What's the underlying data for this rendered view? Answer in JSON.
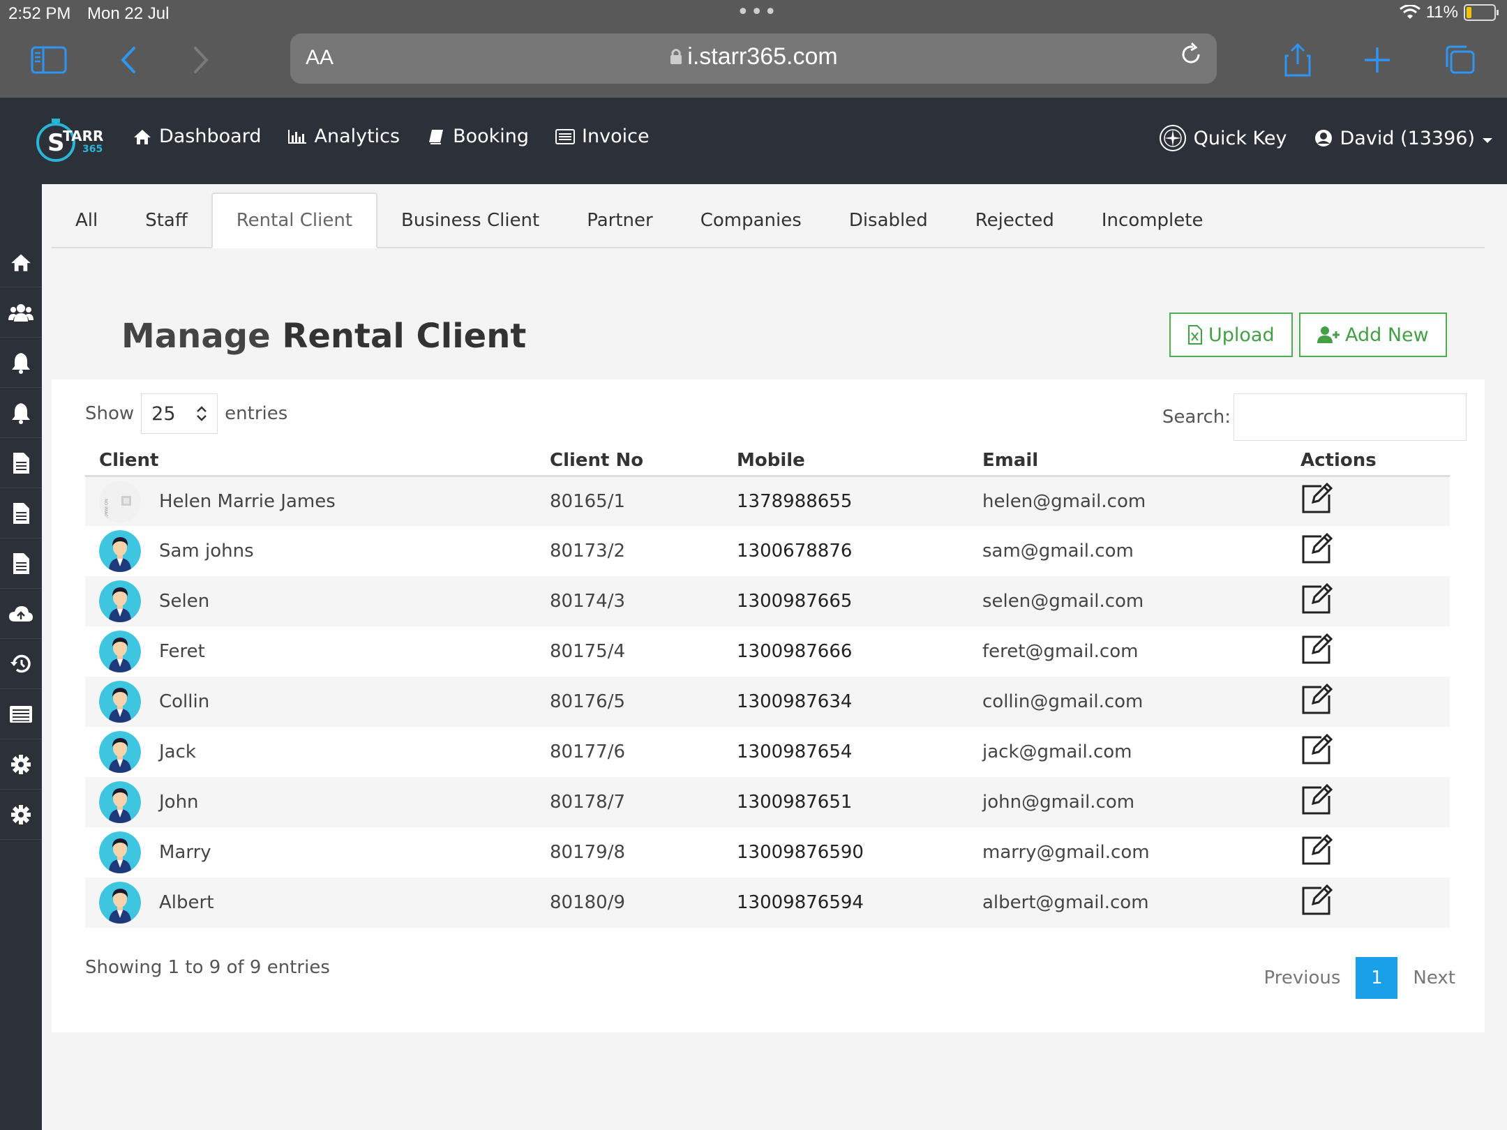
{
  "status_bar": {
    "time": "2:52 PM",
    "date": "Mon 22 Jul",
    "battery": "11%"
  },
  "browser": {
    "text_size": "AA",
    "url": "i.starr365.com"
  },
  "app": {
    "logo_text": "STARR 365",
    "nav": [
      {
        "label": "Dashboard",
        "icon": "home-icon"
      },
      {
        "label": "Analytics",
        "icon": "bar-chart-icon"
      },
      {
        "label": "Booking",
        "icon": "book-icon"
      },
      {
        "label": "Invoice",
        "icon": "list-icon"
      }
    ],
    "quick_key": "Quick Key",
    "user": "David (13396)"
  },
  "sidebar_icons": [
    "home-icon",
    "users-icon",
    "bell-icon",
    "bell-icon",
    "document-icon",
    "document-icon",
    "document-icon",
    "cloud-upload-icon",
    "history-icon",
    "list-icon",
    "gear-icon",
    "gear-icon"
  ],
  "tabs": [
    "All",
    "Staff",
    "Rental Client",
    "Business Client",
    "Partner",
    "Companies",
    "Disabled",
    "Rejected",
    "Incomplete"
  ],
  "active_tab": "Rental Client",
  "page": {
    "title_prefix": "Manage",
    "title_bold": "Rental Client",
    "upload_label": "Upload",
    "add_new_label": "Add New"
  },
  "table_controls": {
    "show_label": "Show",
    "entries_value": "25",
    "entries_label": "entries",
    "search_label": "Search:"
  },
  "table": {
    "columns": [
      "Client",
      "Client No",
      "Mobile",
      "Email",
      "Actions"
    ],
    "rows": [
      {
        "name": "Helen Marrie James",
        "client_no": "80165/1",
        "mobile": "1378988655",
        "email": "helen@gmail.com",
        "avatar": "no-image"
      },
      {
        "name": "Sam johns",
        "client_no": "80173/2",
        "mobile": "1300678876",
        "email": "sam@gmail.com",
        "avatar": "person"
      },
      {
        "name": "Selen",
        "client_no": "80174/3",
        "mobile": "1300987665",
        "email": "selen@gmail.com",
        "avatar": "person"
      },
      {
        "name": "Feret",
        "client_no": "80175/4",
        "mobile": "1300987666",
        "email": "feret@gmail.com",
        "avatar": "person"
      },
      {
        "name": "Collin",
        "client_no": "80176/5",
        "mobile": "1300987634",
        "email": "collin@gmail.com",
        "avatar": "person"
      },
      {
        "name": "Jack",
        "client_no": "80177/6",
        "mobile": "1300987654",
        "email": "jack@gmail.com",
        "avatar": "person"
      },
      {
        "name": "John",
        "client_no": "80178/7",
        "mobile": "1300987651",
        "email": "john@gmail.com",
        "avatar": "person"
      },
      {
        "name": "Marry",
        "client_no": "80179/8",
        "mobile": "13009876590",
        "email": "marry@gmail.com",
        "avatar": "person"
      },
      {
        "name": "Albert",
        "client_no": "80180/9",
        "mobile": "13009876594",
        "email": "albert@gmail.com",
        "avatar": "person"
      }
    ]
  },
  "footer": {
    "showing": "Showing 1 to 9 of 9 entries",
    "previous": "Previous",
    "page": "1",
    "next": "Next"
  },
  "colors": {
    "header_bg": "#2c3039",
    "accent_green": "#4caf50",
    "pager_blue": "#1aa0e8",
    "safari_blue": "#2f95f5"
  }
}
